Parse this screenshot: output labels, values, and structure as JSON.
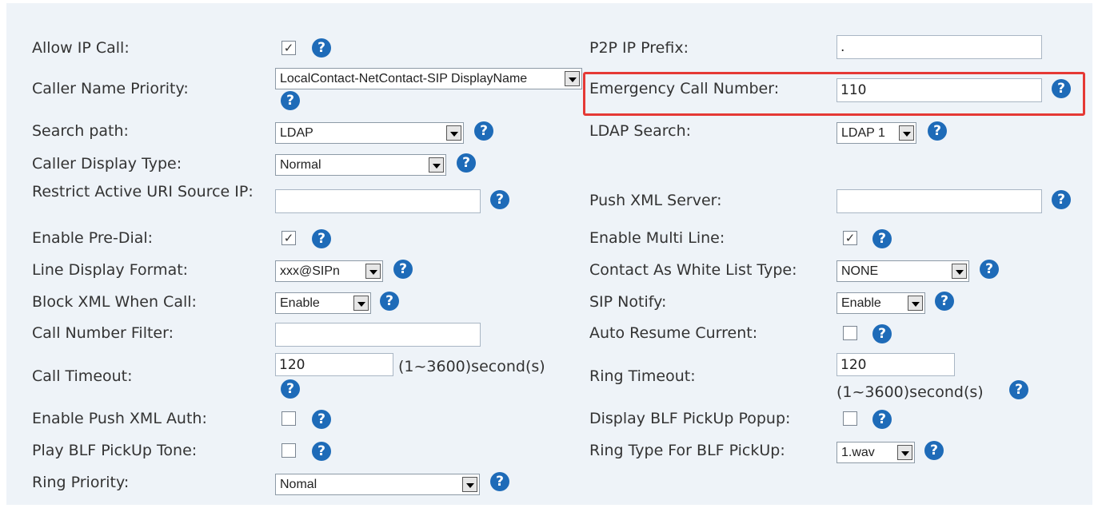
{
  "left": {
    "allow_ip_call": {
      "label": "Allow IP Call:",
      "checked": "✓"
    },
    "caller_name_priority": {
      "label": "Caller Name Priority:",
      "value": "LocalContact-NetContact-SIP DisplayName"
    },
    "search_path": {
      "label": "Search path:",
      "value": "LDAP"
    },
    "caller_display_type": {
      "label": "Caller Display Type:",
      "value": "Normal"
    },
    "restrict_uri_ip": {
      "label": "Restrict Active URI Source IP:",
      "value": ""
    },
    "enable_pre_dial": {
      "label": "Enable Pre-Dial:",
      "checked": "✓"
    },
    "line_display_format": {
      "label": "Line Display Format:",
      "value": "xxx@SIPn"
    },
    "block_xml_when_call": {
      "label": "Block XML When Call:",
      "value": "Enable"
    },
    "call_number_filter": {
      "label": "Call Number Filter:",
      "value": ""
    },
    "call_timeout": {
      "label": "Call Timeout:",
      "value": "120",
      "hint": "(1~3600)second(s)"
    },
    "enable_push_xml_auth": {
      "label": "Enable Push XML Auth:",
      "checked": ""
    },
    "play_blf_pickup_tone": {
      "label": "Play BLF PickUp Tone:",
      "checked": ""
    },
    "ring_priority": {
      "label": "Ring Priority:",
      "value": "Nomal"
    }
  },
  "right": {
    "p2p_ip_prefix": {
      "label": "P2P IP Prefix:",
      "value": "."
    },
    "emergency_call_number": {
      "label": "Emergency Call Number:",
      "value": "110"
    },
    "ldap_search": {
      "label": "LDAP Search:",
      "value": "LDAP 1"
    },
    "push_xml_server": {
      "label": "Push XML Server:",
      "value": ""
    },
    "enable_multi_line": {
      "label": "Enable Multi Line:",
      "checked": "✓"
    },
    "contact_as_white_list_type": {
      "label": "Contact As White List Type:",
      "value": "NONE"
    },
    "sip_notify": {
      "label": "SIP Notify:",
      "value": "Enable"
    },
    "auto_resume_current": {
      "label": "Auto Resume Current:",
      "checked": ""
    },
    "ring_timeout": {
      "label": "Ring Timeout:",
      "value": "120",
      "hint": "(1~3600)second(s)"
    },
    "display_blf_pickup_popup": {
      "label": "Display BLF PickUp Popup:",
      "checked": ""
    },
    "ring_type_for_blf_pickup": {
      "label": "Ring Type For BLF PickUp:",
      "value": "1.wav"
    }
  },
  "help_glyph": "?",
  "colors": {
    "panel_bg": "#eef3f8",
    "help_icon": "#1e6bb8",
    "highlight": "#e53935"
  }
}
